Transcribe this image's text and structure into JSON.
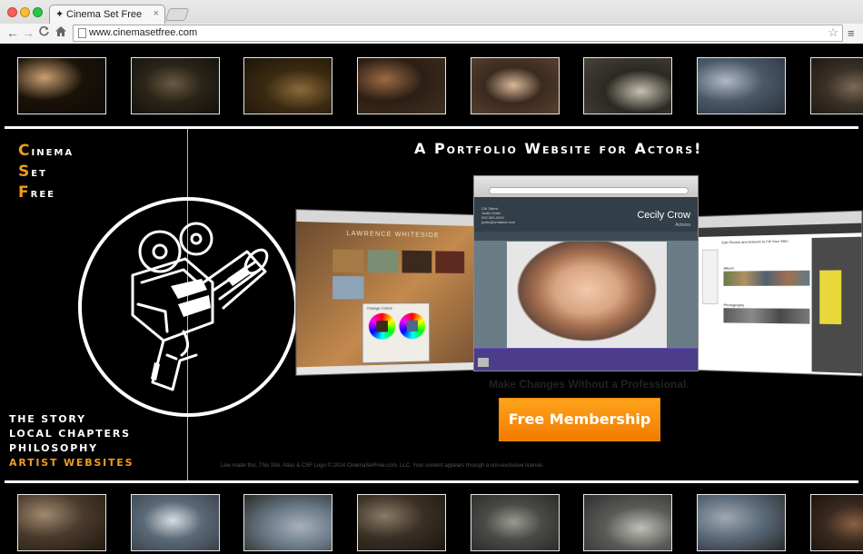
{
  "browser": {
    "tab_title": "Cinema Set Free",
    "tab_close": "×",
    "url": "www.cinemasetfree.com",
    "back_icon": "←",
    "forward_icon": "→",
    "reload_icon": "C",
    "home_icon": "⌂",
    "star_icon": "☆",
    "menu_icon": "≡"
  },
  "brand": {
    "words": [
      {
        "cap": "C",
        "rest": "inema"
      },
      {
        "cap": "S",
        "rest": "et"
      },
      {
        "cap": "F",
        "rest": "ree"
      }
    ],
    "accent": "#f39a1e"
  },
  "headline": "A Portfolio Website for Actors!",
  "nav": [
    {
      "label": "The Story"
    },
    {
      "label": "Local Chapters"
    },
    {
      "label": "Philosophy"
    },
    {
      "label": "Artist Websites",
      "active": true
    }
  ],
  "screens": {
    "center_name": "Cecily Crow",
    "center_role": "Actress",
    "center_agency": "CM Talent\nJustin Hafer\n000 000-0000\njustin@cmtalent.com",
    "left_title": "LAWRENCE WHITESIDE",
    "left_panel_title": "Change Colors",
    "right_heading": "Edit Photos and Artwork to Fill Your Site!",
    "right_section1": "Album",
    "right_section2": "Photography"
  },
  "tagline": "Make Changes Without a Professional.",
  "cta_label": "Free Membership",
  "footer": "Lew made this.   This Site, Atlas & CSF Logo © 2014 CinemaSetFree.com, LLC.   Your content appears through a non-exclusive license.",
  "thumbnails_top": [
    {
      "label": "film-still-1"
    },
    {
      "label": "film-still-2"
    },
    {
      "label": "film-still-3"
    },
    {
      "label": "film-still-4"
    },
    {
      "label": "film-still-5"
    },
    {
      "label": "film-still-6"
    },
    {
      "label": "film-still-7"
    },
    {
      "label": "film-still-8"
    }
  ],
  "thumbnails_bottom": [
    {
      "label": "film-still-9"
    },
    {
      "label": "film-still-10"
    },
    {
      "label": "film-still-11"
    },
    {
      "label": "film-still-12"
    },
    {
      "label": "film-still-13"
    },
    {
      "label": "film-still-14"
    },
    {
      "label": "film-still-15"
    },
    {
      "label": "film-still-16"
    }
  ]
}
